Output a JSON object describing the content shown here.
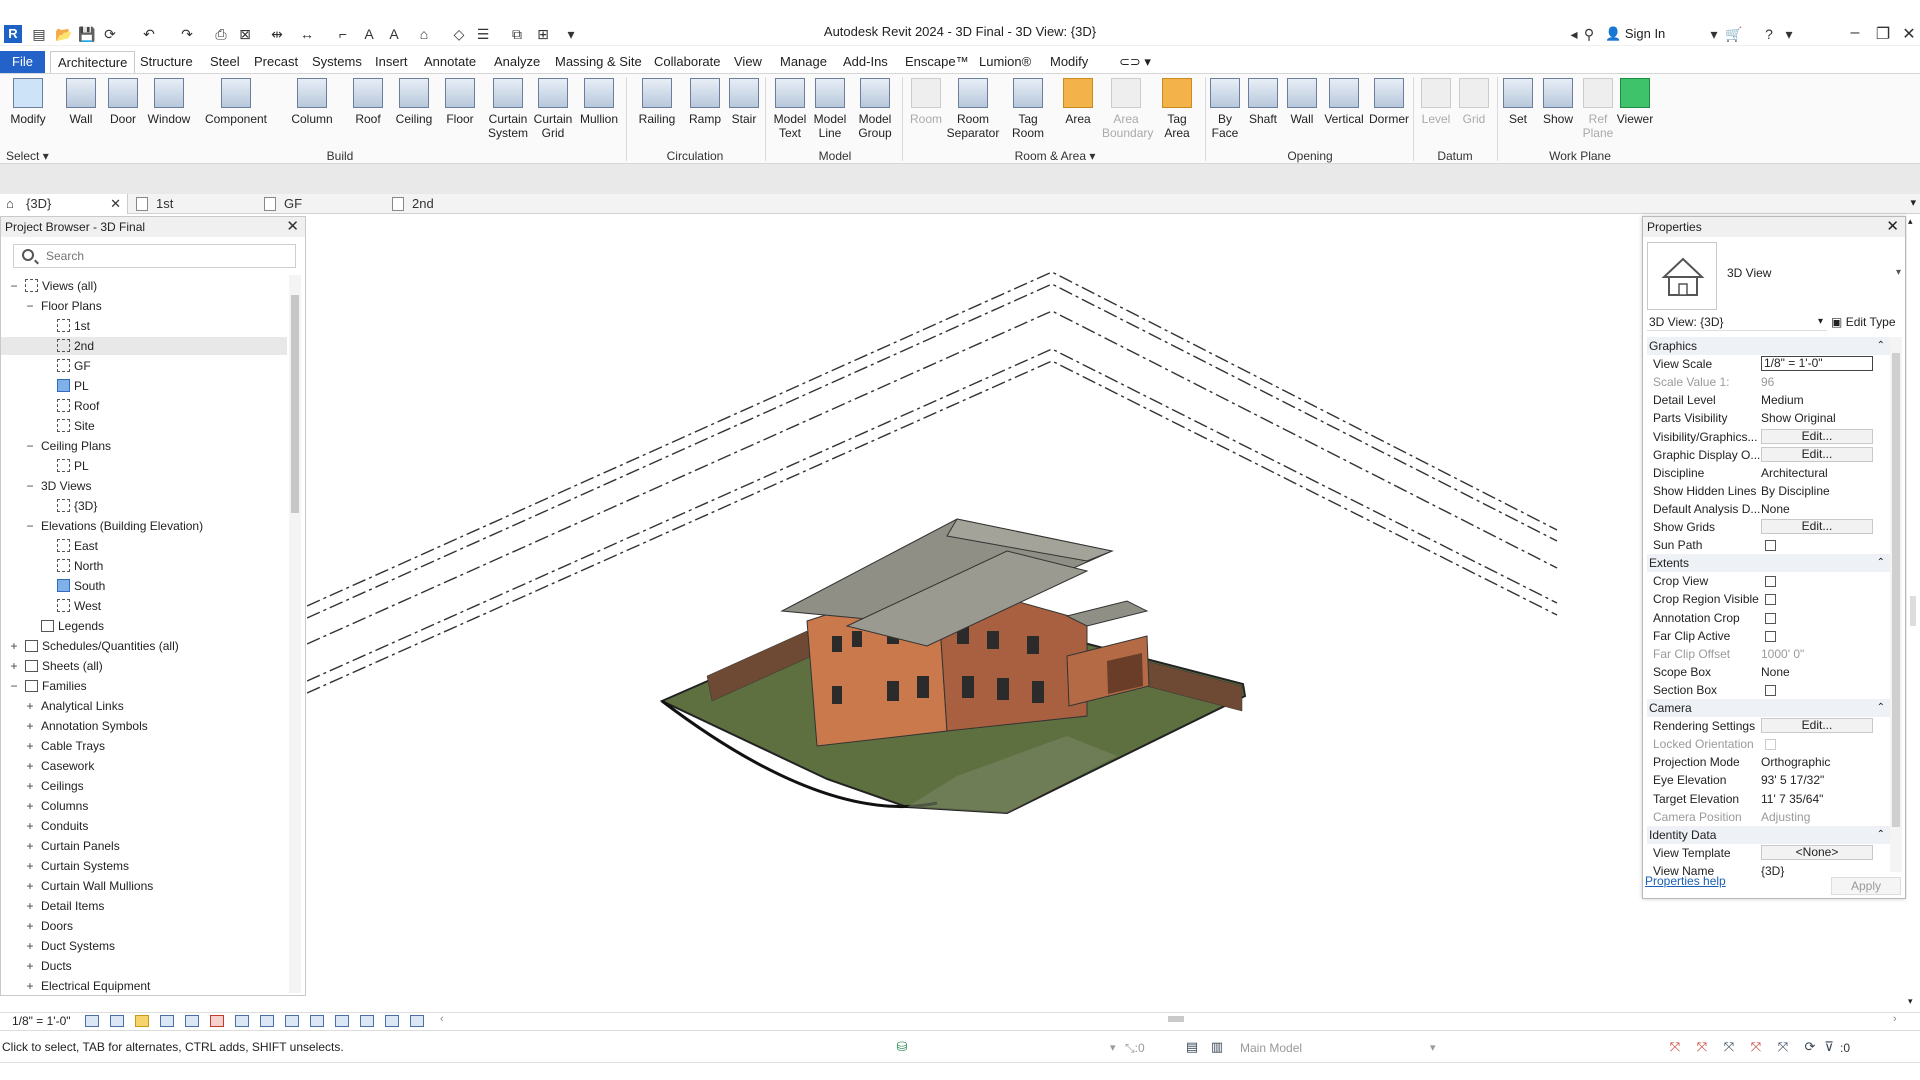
{
  "app": {
    "logo": "R",
    "title": "Autodesk Revit 2024 - 3D Final - 3D View: {3D}",
    "signin": "Sign In",
    "colors": {
      "accent": "#2362c8",
      "ribbon_bg": "#fafafa",
      "roof": "#8f8f85",
      "walls": "#c9794c",
      "terrain": "#5f7040"
    }
  },
  "menu": {
    "tabs": [
      "File",
      "Architecture",
      "Structure",
      "Steel",
      "Precast",
      "Systems",
      "Insert",
      "Annotate",
      "Analyze",
      "Massing & Site",
      "Collaborate",
      "View",
      "Manage",
      "Add-Ins",
      "Enscape™",
      "Lumion®",
      "Modify"
    ]
  },
  "ribbon": {
    "tools": {
      "modify": "Modify",
      "wall": "Wall",
      "door": "Door",
      "window": "Window",
      "component": "Component",
      "column": "Column",
      "roof": "Roof",
      "ceiling": "Ceiling",
      "floor": "Floor",
      "curtain_system": "Curtain System",
      "curtain_grid": "Curtain Grid",
      "mullion": "Mullion",
      "railing": "Railing",
      "ramp": "Ramp",
      "stair": "Stair",
      "model_text": "Model Text",
      "model_line": "Model Line",
      "model_group": "Model Group",
      "room": "Room",
      "room_separator": "Room Separator",
      "tag_room": "Tag Room",
      "area": "Area",
      "area_boundary": "Area Boundary",
      "tag_area": "Tag Area",
      "by_face": "By Face",
      "shaft": "Shaft",
      "wall_opening": "Wall",
      "vertical": "Vertical",
      "dormer": "Dormer",
      "level": "Level",
      "grid": "Grid",
      "set": "Set",
      "show": "Show",
      "ref_plane": "Ref Plane",
      "viewer": "Viewer"
    },
    "panels": {
      "select": "Select",
      "build": "Build",
      "circulation": "Circulation",
      "model": "Model",
      "room_area": "Room & Area",
      "opening": "Opening",
      "datum": "Datum",
      "work_plane": "Work Plane"
    }
  },
  "view_tabs": [
    "{3D}",
    "1st",
    "GF",
    "2nd"
  ],
  "project_browser": {
    "title": "Project Browser - 3D Final",
    "search_placeholder": "Search",
    "tree": [
      {
        "label": "Views (all)",
        "toggle": "−"
      },
      {
        "label": "Floor Plans",
        "toggle": "−"
      },
      {
        "label": "1st"
      },
      {
        "label": "2nd"
      },
      {
        "label": "GF"
      },
      {
        "label": "PL"
      },
      {
        "label": "Roof"
      },
      {
        "label": "Site"
      },
      {
        "label": "Ceiling Plans",
        "toggle": "−"
      },
      {
        "label": "PL"
      },
      {
        "label": "3D Views",
        "toggle": "−"
      },
      {
        "label": "{3D}"
      },
      {
        "label": "Elevations (Building Elevation)",
        "toggle": "−"
      },
      {
        "label": "East"
      },
      {
        "label": "North"
      },
      {
        "label": "South"
      },
      {
        "label": "West"
      },
      {
        "label": "Legends"
      },
      {
        "label": "Schedules/Quantities (all)",
        "toggle": "+"
      },
      {
        "label": "Sheets (all)",
        "toggle": "+"
      },
      {
        "label": "Families",
        "toggle": "−"
      },
      {
        "label": "Analytical Links",
        "toggle": "+"
      },
      {
        "label": "Annotation Symbols",
        "toggle": "+"
      },
      {
        "label": "Cable Trays",
        "toggle": "+"
      },
      {
        "label": "Casework",
        "toggle": "+"
      },
      {
        "label": "Ceilings",
        "toggle": "+"
      },
      {
        "label": "Columns",
        "toggle": "+"
      },
      {
        "label": "Conduits",
        "toggle": "+"
      },
      {
        "label": "Curtain Panels",
        "toggle": "+"
      },
      {
        "label": "Curtain Systems",
        "toggle": "+"
      },
      {
        "label": "Curtain Wall Mullions",
        "toggle": "+"
      },
      {
        "label": "Detail Items",
        "toggle": "+"
      },
      {
        "label": "Doors",
        "toggle": "+"
      },
      {
        "label": "Duct Systems",
        "toggle": "+"
      },
      {
        "label": "Ducts",
        "toggle": "+"
      },
      {
        "label": "Electrical Equipment",
        "toggle": "+"
      }
    ]
  },
  "properties": {
    "title": "Properties",
    "type_name": "3D View",
    "instance_filter": "3D View: {3D}",
    "edit_type": "Edit Type",
    "rows": [
      {
        "group": "Graphics"
      },
      {
        "name": "View Scale",
        "value": "1/8\" = 1'-0\"",
        "kind": "input"
      },
      {
        "name": "Scale Value    1:",
        "value": "96",
        "dim": true
      },
      {
        "name": "Detail Level",
        "value": "Medium"
      },
      {
        "name": "Parts Visibility",
        "value": "Show Original"
      },
      {
        "name": "Visibility/Graphics...",
        "value": "Edit...",
        "kind": "button"
      },
      {
        "name": "Graphic Display O...",
        "value": "Edit...",
        "kind": "button"
      },
      {
        "name": "Discipline",
        "value": "Architectural"
      },
      {
        "name": "Show Hidden Lines",
        "value": "By Discipline"
      },
      {
        "name": "Default Analysis D...",
        "value": "None"
      },
      {
        "name": "Show Grids",
        "value": "Edit...",
        "kind": "button"
      },
      {
        "name": "Sun Path",
        "kind": "checkbox"
      },
      {
        "group": "Extents"
      },
      {
        "name": "Crop View",
        "kind": "checkbox"
      },
      {
        "name": "Crop Region Visible",
        "kind": "checkbox"
      },
      {
        "name": "Annotation Crop",
        "kind": "checkbox"
      },
      {
        "name": "Far Clip Active",
        "kind": "checkbox"
      },
      {
        "name": "Far Clip Offset",
        "value": "1000'  0\"",
        "dim": true
      },
      {
        "name": "Scope Box",
        "value": "None"
      },
      {
        "name": "Section Box",
        "kind": "checkbox"
      },
      {
        "group": "Camera"
      },
      {
        "name": "Rendering Settings",
        "value": "Edit...",
        "kind": "button"
      },
      {
        "name": "Locked Orientation",
        "kind": "checkbox",
        "dim": true
      },
      {
        "name": "Projection Mode",
        "value": "Orthographic"
      },
      {
        "name": "Eye Elevation",
        "value": "93'  5 17/32\""
      },
      {
        "name": "Target Elevation",
        "value": "11'  7 35/64\""
      },
      {
        "name": "Camera Position",
        "value": "Adjusting",
        "dim": true
      },
      {
        "group": "Identity Data"
      },
      {
        "name": "View Template",
        "value": "<None>",
        "kind": "button"
      },
      {
        "name": "View Name",
        "value": "{3D}"
      }
    ],
    "help": "Properties help",
    "apply": "Apply"
  },
  "view_control": {
    "scale": "1/8\" = 1'-0\""
  },
  "status": {
    "text": "Click to select, TAB for alternates, CTRL adds, SHIFT unselects.",
    "worksharing": ":0",
    "model": "Main Model",
    "filter": ":0"
  }
}
